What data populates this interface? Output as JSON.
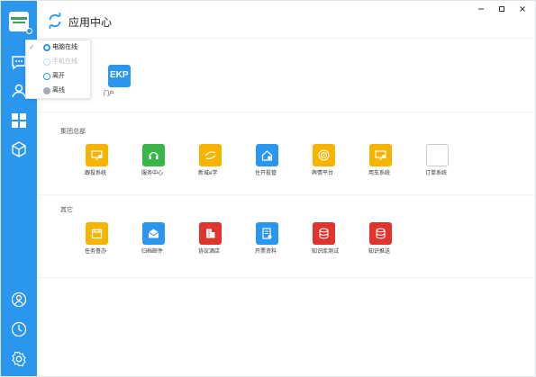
{
  "app": {
    "title": "应用中心"
  },
  "user_menu": {
    "items": [
      {
        "label": "电脑在线",
        "checked": true,
        "color": "#2a96ee",
        "text_color": "#222222"
      },
      {
        "label": "手机在线",
        "checked": false,
        "color": "#2a96ee",
        "text_color": "#b8bcc3"
      },
      {
        "label": "离开",
        "checked": false,
        "color": "#2a96ee",
        "text_color": "#333333"
      },
      {
        "label": "离线",
        "checked": false,
        "color": "#a7abb3",
        "text_color": "#333333"
      }
    ]
  },
  "sections": [
    {
      "title": "",
      "apps": [
        {
          "label": "门户",
          "badge": "EKP",
          "icon": "ekp-icon",
          "color": "#2a96ee"
        }
      ]
    },
    {
      "title": "集团总部",
      "apps": [
        {
          "label": "跟投系统",
          "icon": "monitor-gear-icon",
          "color": "#f6b400"
        },
        {
          "label": "服务中心",
          "icon": "headset-icon",
          "color": "#3ab54a"
        },
        {
          "label": "新城e学",
          "icon": "e-learning-icon",
          "color": "#f6b400"
        },
        {
          "label": "住开投管",
          "icon": "house-gear-icon",
          "color": "#2a96ee"
        },
        {
          "label": "舆情平台",
          "icon": "broadcast-icon",
          "color": "#f6b400"
        },
        {
          "label": "用车系统",
          "icon": "monitor-gear-icon",
          "color": "#f6b400"
        },
        {
          "label": "订单系统",
          "icon": "blank-icon",
          "color": "#ffffff"
        }
      ]
    },
    {
      "title": "其它",
      "apps": [
        {
          "label": "任务督办",
          "icon": "calendar-icon",
          "color": "#f6b400"
        },
        {
          "label": "归档邮件",
          "icon": "mail-icon",
          "color": "#2a96ee"
        },
        {
          "label": "协议酒店",
          "icon": "building-icon",
          "color": "#e0342f"
        },
        {
          "label": "开票资料",
          "icon": "invoice-icon",
          "color": "#2a96ee"
        },
        {
          "label": "知识库测试",
          "icon": "database-icon",
          "color": "#e0342f"
        },
        {
          "label": "知识推送",
          "icon": "database-icon",
          "color": "#e0342f"
        }
      ]
    }
  ]
}
